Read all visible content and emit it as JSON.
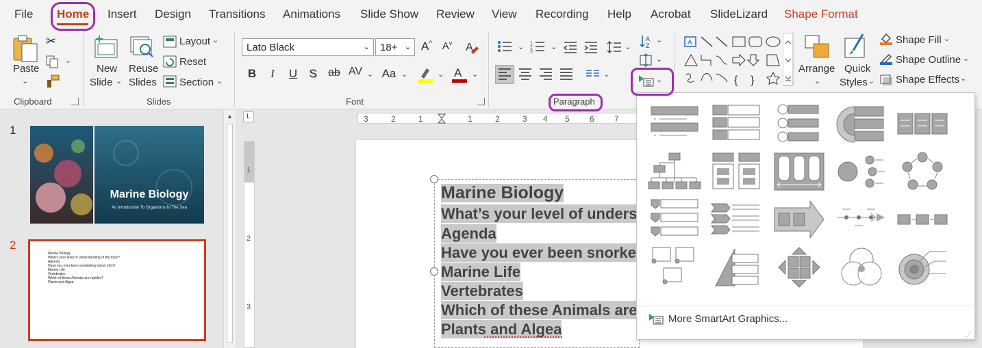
{
  "tabs": [
    {
      "label": "File"
    },
    {
      "label": "Home"
    },
    {
      "label": "Insert"
    },
    {
      "label": "Design"
    },
    {
      "label": "Transitions"
    },
    {
      "label": "Animations"
    },
    {
      "label": "Slide Show"
    },
    {
      "label": "Review"
    },
    {
      "label": "View"
    },
    {
      "label": "Recording"
    },
    {
      "label": "Help"
    },
    {
      "label": "Acrobat"
    },
    {
      "label": "SlideLizard"
    },
    {
      "label": "Shape Format"
    }
  ],
  "ribbon": {
    "clipboard": {
      "paste": "Paste",
      "group": "Clipboard"
    },
    "slides": {
      "new_slide_1": "New",
      "new_slide_2": "Slide",
      "reuse_1": "Reuse",
      "reuse_2": "Slides",
      "layout": "Layout",
      "reset": "Reset",
      "section": "Section",
      "group": "Slides"
    },
    "font": {
      "name": "Lato Black",
      "size": "18+",
      "group": "Font",
      "bold": "B",
      "italic": "I",
      "underline": "U",
      "shadow": "S",
      "strike": "ab",
      "spacing": "AV",
      "case": "Aa",
      "grow": "A",
      "shrink": "A"
    },
    "paragraph": {
      "group": "Paragraph"
    },
    "drawing": {
      "arrange": "Arrange",
      "quick_1": "Quick",
      "quick_2": "Styles",
      "fill": "Shape Fill",
      "outline": "Shape Outline",
      "effects": "Shape Effects"
    }
  },
  "ruler": {
    "h": [
      "3",
      "2",
      "1",
      "1",
      "2",
      "3",
      "4",
      "5",
      "6",
      "7"
    ],
    "v": [
      "1",
      "2",
      "3"
    ]
  },
  "thumbnails": [
    {
      "num": "1",
      "title": "Marine Biology",
      "subtitle": "An Introduction To Organisms In The Sea"
    },
    {
      "num": "2",
      "lines": [
        "Marine Biology",
        "What's your level of understanding of the topic?",
        "Agenda",
        "Have you ever been snorkelling below 10m?",
        "Marine Life",
        "Vertebrates",
        "Which of these Animals are reptiles?",
        "Plants and Algea"
      ]
    }
  ],
  "slide_lines": [
    "Marine Biology",
    "What’s your level of unders",
    "Agenda",
    "Have you ever been snorke",
    "Marine Life",
    "Vertebrates",
    "Which of these Animals are",
    "Plants and Algea"
  ],
  "gallery": {
    "more": "More SmartArt Graphics..."
  },
  "colors": {
    "accent": "#c43e1c",
    "highlight": "#9b2fae",
    "font_bar_color": "#ffff00",
    "font_color_bar": "#c00000"
  }
}
